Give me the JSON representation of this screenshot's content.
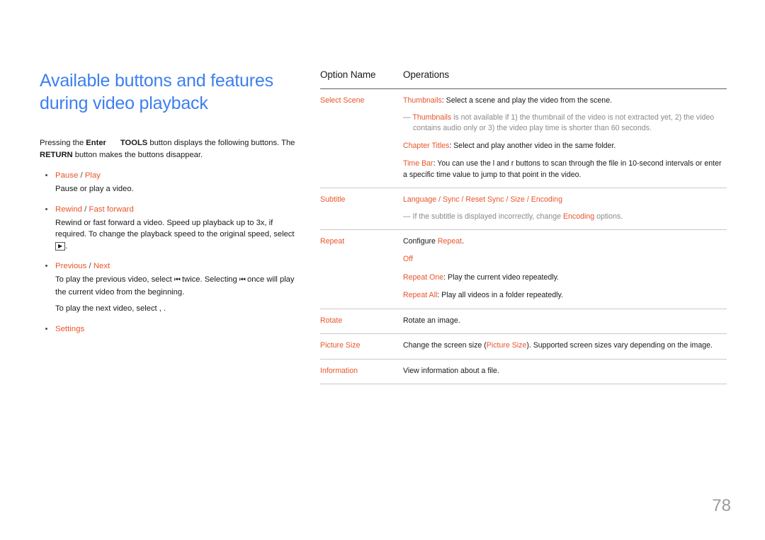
{
  "left": {
    "title": "Available buttons and features\nduring video playback",
    "intro_part1": "Pressing the ",
    "intro_kbd1": "Enter",
    "intro_part2": " ",
    "intro_kbd2": "TOOLS",
    "intro_part3": " button displays the following buttons. The ",
    "intro_kbd3": "RETURN",
    "intro_part4": " button makes the buttons disappear.",
    "bullets": [
      {
        "head_a": "Pause",
        "sep": " / ",
        "head_b": "Play",
        "body": "Pause or play a video."
      },
      {
        "head_a": "Rewind",
        "sep": " / ",
        "head_b": "Fast forward",
        "body": "Rewind or fast forward a video. Speed up playback up to 3x, if required. To change the playback speed to the original speed, select",
        "body_glyph": "▶",
        "body_tail": "."
      },
      {
        "head_a": "Previous",
        "sep": " / ",
        "head_b": "Next",
        "body_pre": "To play the previous video, select ",
        "body_glyph1": "⏮",
        "body_mid": " twice. Selecting ",
        "body_glyph2": "⏮",
        "body_post": " once will play the current video from the beginning.",
        "body2": "To play the next video, select ,   ."
      },
      {
        "head_a": "Settings",
        "sep": "",
        "head_b": ""
      }
    ]
  },
  "table": {
    "header": {
      "col1": "Option Name",
      "col2": "Operations"
    },
    "rows": [
      {
        "name": "Select Scene",
        "lines": [
          {
            "type": "text",
            "orange": "Thumbnails",
            "rest": ": Select a scene and play the video from the scene."
          },
          {
            "type": "note",
            "dash": "—",
            "orange": "Thumbnails",
            "rest": " is not available if 1) the thumbnail of the video is not extracted yet, 2) the video contains audio only or 3) the video play time is shorter than 60 seconds."
          },
          {
            "type": "text",
            "orange": "Chapter Titles",
            "rest": ": Select and play another video in the same folder."
          },
          {
            "type": "text",
            "orange": "Time Bar",
            "rest": ": You can use the l and  r buttons to scan through the file in 10-second intervals or enter a specific time value to jump to that point in the video."
          }
        ]
      },
      {
        "name": "Subtitle",
        "lines": [
          {
            "type": "allorange",
            "orange": "Language / Sync / Reset Sync / Size / Encoding",
            "rest": ""
          },
          {
            "type": "note",
            "dash": "—",
            "pre": "If the subtitle is displayed incorrectly, change ",
            "orange": "Encoding",
            "rest": " options."
          }
        ]
      },
      {
        "name": "Repeat",
        "lines": [
          {
            "type": "text",
            "pre": "Configure ",
            "orange": "Repeat",
            "rest": "."
          },
          {
            "type": "allorange",
            "orange": "Off",
            "rest": ""
          },
          {
            "type": "text",
            "orange": "Repeat One",
            "rest": ": Play the current video repeatedly."
          },
          {
            "type": "text",
            "orange": "Repeat All",
            "rest": ": Play all videos in a folder repeatedly."
          }
        ]
      },
      {
        "name": "Rotate",
        "lines": [
          {
            "type": "text",
            "orange": "",
            "rest": "Rotate an image."
          }
        ]
      },
      {
        "name": "Picture Size",
        "lines": [
          {
            "type": "text",
            "pre": "Change the screen size (",
            "orange": "Picture Size",
            "rest": "). Supported screen sizes vary depending on the image."
          }
        ]
      },
      {
        "name": "Information",
        "lines": [
          {
            "type": "text",
            "orange": "",
            "rest": "View information about a file."
          }
        ]
      }
    ]
  },
  "footer": {
    "page_number": "78"
  }
}
